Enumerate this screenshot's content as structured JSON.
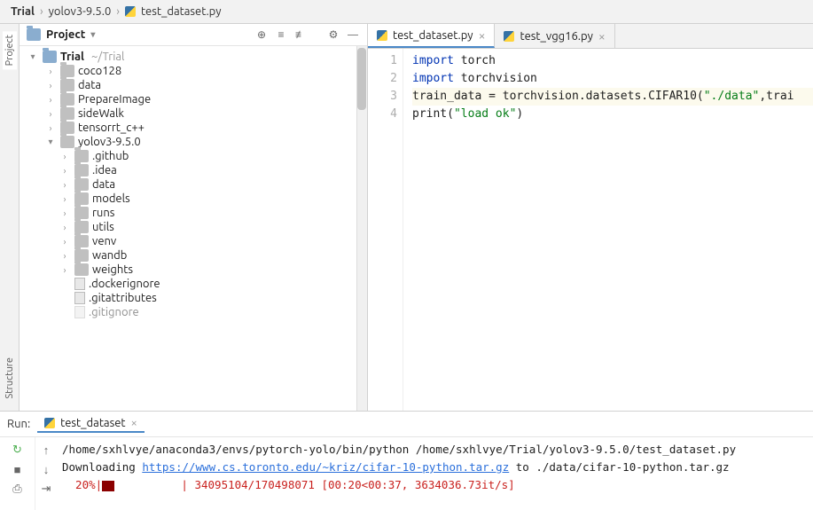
{
  "breadcrumb": {
    "root": "Trial",
    "mid": "yolov3-9.5.0",
    "file": "test_dataset.py"
  },
  "left_rail": {
    "project": "Project",
    "structure": "Structure"
  },
  "project_panel": {
    "title": "Project"
  },
  "tree": {
    "root": "Trial",
    "root_path": "~/Trial",
    "items": [
      "coco128",
      "data",
      "PrepareImage",
      "sideWalk",
      "tensorrt_c++",
      "yolov3-9.5.0"
    ],
    "yolov3_children": [
      ".github",
      ".idea",
      "data",
      "models",
      "runs",
      "utils",
      "venv",
      "wandb",
      "weights"
    ],
    "yolov3_files": [
      ".dockerignore",
      ".gitattributes",
      ".gitignore"
    ]
  },
  "tabs": {
    "active": "test_dataset.py",
    "inactive": "test_vgg16.py"
  },
  "code": {
    "line1_kw": "import",
    "line1_rest": " torch",
    "line2_kw": "import",
    "line2_rest": " torchvision",
    "line3_a": "train_data = torchvision.datasets.CIFAR10(",
    "line3_str": "\"./data\"",
    "line3_b": ",trai",
    "line4_a": "print(",
    "line4_str": "\"load ok\"",
    "line4_b": ")",
    "gutter": [
      "1",
      "2",
      "3",
      "4"
    ]
  },
  "run": {
    "title": "Run:",
    "tab": "test_dataset",
    "out1_pre": "/home/sxhlvye/anaconda3/envs/pytorch-yolo/bin/python /home/sxhlvye/Trial/yolov3-9.5.0/test_dataset.py",
    "out2_pre": "Downloading ",
    "out2_link": "https://www.cs.toronto.edu/~kriz/cifar-10-python.tar.gz",
    "out2_post": " to ./data/cifar-10-python.tar.gz",
    "out3_pct": "  20%|",
    "out3_mid": "          | ",
    "out3_stat": "34095104/170498071 [00:20<00:37, 3634036.73it/s]"
  }
}
